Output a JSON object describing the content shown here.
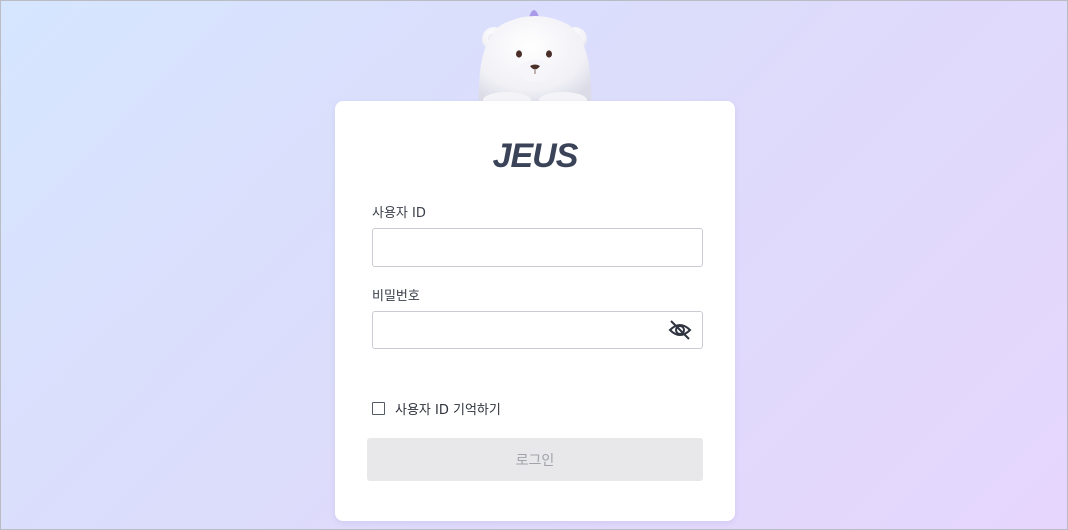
{
  "brand": {
    "logo_text": "JEUS",
    "mascot": "polar-bear-mascot"
  },
  "login_form": {
    "user_id_label": "사용자 ID",
    "user_id_value": "",
    "password_label": "비밀번호",
    "password_value": "",
    "password_toggle_icon": "eye-slash-icon",
    "remember_label": "사용자 ID 기억하기",
    "remember_checked": false,
    "login_button_label": "로그인",
    "login_button_enabled": false
  },
  "colors": {
    "background_start": "#d6e6ff",
    "background_end": "#e6d6fd",
    "logo": "#3b4358",
    "button_disabled_bg": "#e8e8ea",
    "button_disabled_text": "#a0a3aa"
  }
}
